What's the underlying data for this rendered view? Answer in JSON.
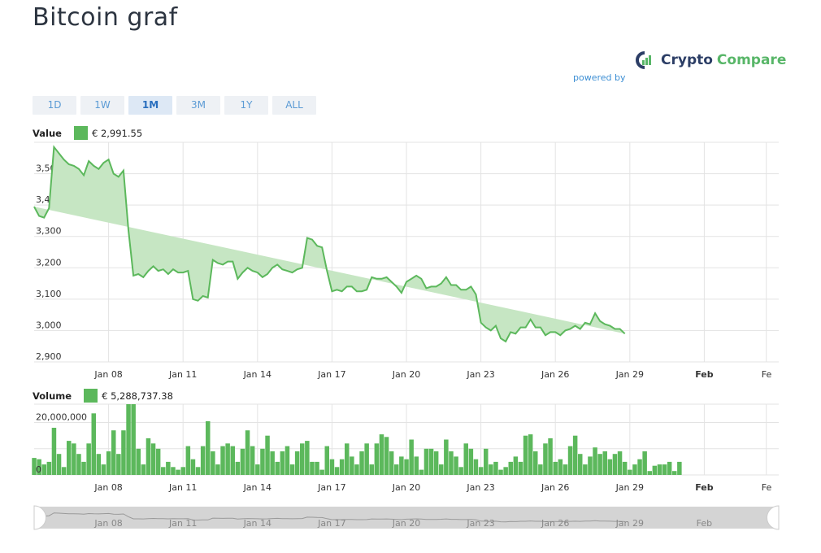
{
  "page": {
    "title": "Bitcoin graf"
  },
  "brand": {
    "powered_by": "powered by",
    "name_part1": "Crypto",
    "name_part2": "Compare"
  },
  "ranges": [
    {
      "label": "1D",
      "active": false
    },
    {
      "label": "1W",
      "active": false
    },
    {
      "label": "1M",
      "active": true
    },
    {
      "label": "3M",
      "active": false
    },
    {
      "label": "1Y",
      "active": false
    },
    {
      "label": "ALL",
      "active": false
    }
  ],
  "value_legend": {
    "label": "Value",
    "value": "€ 2,991.55"
  },
  "volume_legend": {
    "label": "Volume",
    "value": "€ 5,288,737.38"
  },
  "colors": {
    "line": "#5cb85c",
    "fill": "#c6e6c3",
    "bar": "#5cb85c",
    "grid": "#e3e3e3",
    "navigator": "#b8b8b8"
  },
  "x_ticks": [
    "Jan 08",
    "Jan 11",
    "Jan 14",
    "Jan 17",
    "Jan 20",
    "Jan 23",
    "Jan 26",
    "Jan 29",
    "Feb",
    "Fe"
  ],
  "chart_data": [
    {
      "type": "area",
      "ylim": [
        2900,
        3600
      ],
      "yticks": [
        "2,900",
        "3,000",
        "3,100",
        "3,200",
        "3,300",
        "3,400",
        "3,500"
      ],
      "xlim": [
        5.0,
        35.0
      ],
      "x": [
        5.0,
        5.2,
        5.4,
        5.6,
        5.8,
        6.0,
        6.2,
        6.4,
        6.6,
        6.8,
        7.0,
        7.2,
        7.4,
        7.6,
        7.8,
        8.0,
        8.2,
        8.4,
        8.6,
        8.8,
        9.0,
        9.2,
        9.4,
        9.6,
        9.8,
        10.0,
        10.2,
        10.4,
        10.6,
        10.8,
        11.0,
        11.2,
        11.4,
        11.6,
        11.8,
        12.0,
        12.2,
        12.4,
        12.6,
        12.8,
        13.0,
        13.2,
        13.4,
        13.6,
        13.8,
        14.0,
        14.2,
        14.4,
        14.6,
        14.8,
        15.0,
        15.2,
        15.4,
        15.6,
        15.8,
        16.0,
        16.2,
        16.4,
        16.6,
        16.8,
        17.0,
        17.2,
        17.4,
        17.6,
        17.8,
        18.0,
        18.2,
        18.4,
        18.6,
        18.8,
        19.0,
        19.2,
        19.4,
        19.6,
        19.8,
        20.0,
        20.2,
        20.4,
        20.6,
        20.8,
        21.0,
        21.2,
        21.4,
        21.6,
        21.8,
        22.0,
        22.2,
        22.4,
        22.6,
        22.8,
        23.0,
        23.2,
        23.4,
        23.6,
        23.8,
        24.0,
        24.2,
        24.4,
        24.6,
        24.8,
        25.0,
        25.2,
        25.4,
        25.6,
        25.8,
        26.0,
        26.2,
        26.4,
        26.6,
        26.8,
        27.0,
        27.2,
        27.4,
        27.6,
        27.8,
        28.0,
        28.2,
        28.4,
        28.6,
        28.8,
        29.0,
        29.2,
        29.4,
        29.6,
        29.8,
        30.0,
        30.2,
        30.4,
        30.6,
        30.8,
        31.0,
        31.2,
        31.4,
        31.6,
        31.8,
        32.0,
        32.2,
        32.4,
        32.6,
        32.8,
        33.0,
        33.2,
        33.4,
        33.6,
        33.8,
        34.0,
        34.2,
        34.4
      ],
      "values": [
        3395,
        3365,
        3360,
        3390,
        3585,
        3565,
        3545,
        3530,
        3525,
        3515,
        3495,
        3540,
        3525,
        3515,
        3535,
        3545,
        3500,
        3490,
        3510,
        3320,
        3175,
        3180,
        3170,
        3190,
        3205,
        3190,
        3195,
        3180,
        3195,
        3185,
        3185,
        3190,
        3100,
        3095,
        3110,
        3105,
        3225,
        3215,
        3210,
        3220,
        3220,
        3165,
        3185,
        3200,
        3190,
        3185,
        3170,
        3180,
        3200,
        3210,
        3195,
        3190,
        3185,
        3195,
        3200,
        3295,
        3290,
        3270,
        3265,
        3190,
        3125,
        3130,
        3125,
        3140,
        3140,
        3125,
        3125,
        3130,
        3170,
        3165,
        3165,
        3170,
        3155,
        3140,
        3120,
        3155,
        3165,
        3175,
        3165,
        3135,
        3140,
        3140,
        3150,
        3170,
        3145,
        3145,
        3130,
        3130,
        3140,
        3115,
        3025,
        3010,
        3000,
        3015,
        2975,
        2965,
        2995,
        2990,
        3010,
        3010,
        3035,
        3010,
        3010,
        2985,
        2995,
        2995,
        2985,
        3000,
        3005,
        3015,
        3005,
        3025,
        3020,
        3055,
        3030,
        3020,
        3015,
        3005,
        3005,
        2990
      ]
    },
    {
      "type": "bar",
      "ylim": [
        0,
        27000000
      ],
      "yticks": [
        "0",
        "20,000,000"
      ],
      "xlim": [
        5.0,
        35.0
      ],
      "x": [
        5.0,
        5.2,
        5.4,
        5.6,
        5.8,
        6.0,
        6.2,
        6.4,
        6.6,
        6.8,
        7.0,
        7.2,
        7.4,
        7.6,
        7.8,
        8.0,
        8.2,
        8.4,
        8.6,
        8.8,
        9.0,
        9.2,
        9.4,
        9.6,
        9.8,
        10.0,
        10.2,
        10.4,
        10.6,
        10.8,
        11.0,
        11.2,
        11.4,
        11.6,
        11.8,
        12.0,
        12.2,
        12.4,
        12.6,
        12.8,
        13.0,
        13.2,
        13.4,
        13.6,
        13.8,
        14.0,
        14.2,
        14.4,
        14.6,
        14.8,
        15.0,
        15.2,
        15.4,
        15.6,
        15.8,
        16.0,
        16.2,
        16.4,
        16.6,
        16.8,
        17.0,
        17.2,
        17.4,
        17.6,
        17.8,
        18.0,
        18.2,
        18.4,
        18.6,
        18.8,
        19.0,
        19.2,
        19.4,
        19.6,
        19.8,
        20.0,
        20.2,
        20.4,
        20.6,
        20.8,
        21.0,
        21.2,
        21.4,
        21.6,
        21.8,
        22.0,
        22.2,
        22.4,
        22.6,
        22.8,
        23.0,
        23.2,
        23.4,
        23.6,
        23.8,
        24.0,
        24.2,
        24.4,
        24.6,
        24.8,
        25.0,
        25.2,
        25.4,
        25.6,
        25.8,
        26.0,
        26.2,
        26.4,
        26.6,
        26.8,
        27.0,
        27.2,
        27.4,
        27.6,
        27.8,
        28.0,
        28.2,
        28.4,
        28.6,
        28.8,
        29.0,
        29.2,
        29.4,
        29.6,
        29.8,
        30.0,
        30.2,
        30.4,
        30.6,
        30.8,
        31.0,
        31.2,
        31.4,
        31.6,
        31.8,
        32.0,
        32.2,
        32.4,
        32.6,
        32.8,
        33.0,
        33.2,
        33.4,
        33.6,
        33.8,
        34.0,
        34.2,
        34.4
      ],
      "values": [
        6500000,
        6000000,
        4000000,
        5000000,
        18000000,
        8000000,
        3000000,
        13000000,
        12000000,
        8000000,
        5000000,
        12000000,
        23500000,
        8000000,
        4000000,
        9000000,
        17000000,
        8000000,
        17000000,
        33000000,
        28000000,
        10000000,
        4000000,
        14000000,
        12000000,
        10000000,
        3000000,
        5000000,
        3000000,
        2000000,
        3000000,
        11000000,
        6000000,
        3000000,
        11000000,
        20500000,
        9000000,
        4000000,
        11000000,
        12000000,
        11000000,
        5000000,
        10000000,
        17000000,
        11000000,
        4000000,
        10000000,
        15000000,
        9000000,
        5000000,
        9000000,
        11000000,
        4000000,
        9000000,
        12000000,
        13000000,
        5000000,
        5000000,
        2000000,
        11000000,
        6000000,
        3000000,
        6000000,
        12000000,
        7000000,
        4000000,
        9000000,
        12000000,
        4000000,
        12000000,
        15500000,
        14500000,
        9000000,
        4000000,
        7000000,
        6000000,
        13500000,
        7000000,
        2000000,
        10000000,
        10000000,
        9000000,
        4000000,
        13500000,
        9000000,
        7000000,
        3000000,
        12000000,
        10000000,
        6000000,
        3000000,
        10000000,
        4000000,
        5000000,
        2000000,
        3000000,
        5000000,
        7000000,
        5000000,
        15000000,
        15500000,
        9000000,
        4000000,
        12000000,
        14000000,
        5000000,
        6000000,
        4000000,
        11000000,
        15000000,
        8000000,
        4000000,
        7000000,
        10500000,
        8000000,
        9000000,
        6000000,
        8000000,
        9000000,
        5000000,
        2000000,
        4000000,
        6000000,
        9000000,
        1500000,
        3500000,
        4000000,
        4000000,
        5000000,
        1500000,
        5000000
      ]
    }
  ]
}
